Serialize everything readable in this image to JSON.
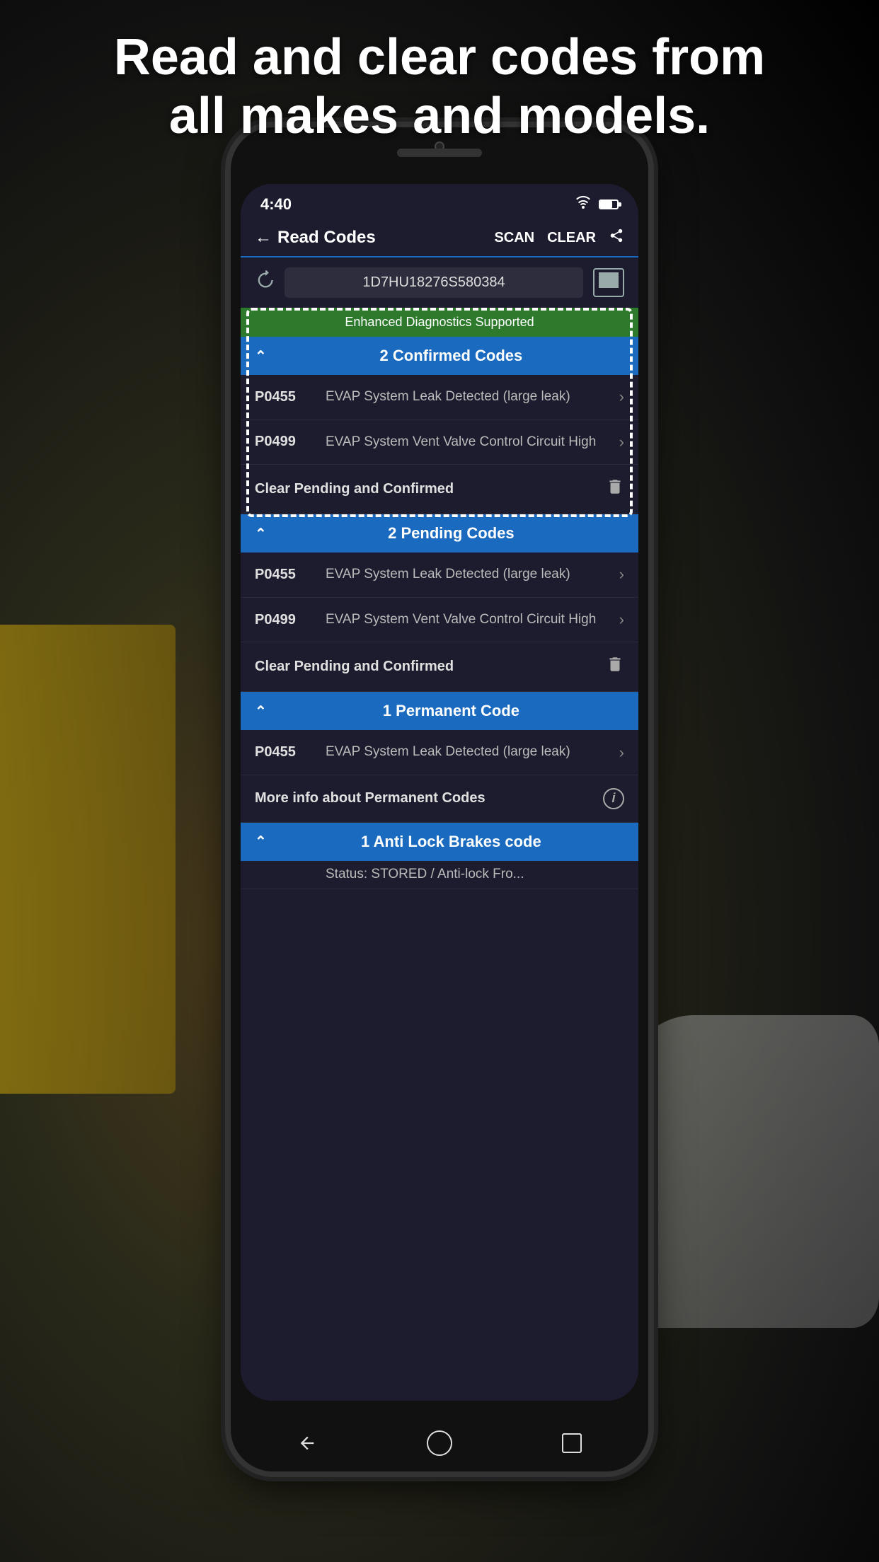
{
  "headline": {
    "line1": "Read and clear codes from",
    "line2": "all makes and models."
  },
  "status_bar": {
    "time": "4:40",
    "wifi": "▲",
    "battery_label": "battery"
  },
  "top_bar": {
    "back_label": "← Read Codes",
    "scan_label": "SCAN",
    "clear_label": "CLEAR",
    "share_icon": "share"
  },
  "vin_bar": {
    "vin_value": "1D7HU18276S580384",
    "history_icon": "history",
    "barcode_icon": "barcode"
  },
  "sections": [
    {
      "id": "confirmed",
      "banner": "Enhanced Diagnostics Supported",
      "title": "2 Confirmed Codes",
      "codes": [
        {
          "code": "P0455",
          "description": "EVAP System Leak Detected (large leak)"
        },
        {
          "code": "P0499",
          "description": "EVAP System Vent Valve Control Circuit High"
        }
      ],
      "clear_label": "Clear Pending and Confirmed",
      "has_banner": true
    },
    {
      "id": "pending",
      "title": "2 Pending Codes",
      "codes": [
        {
          "code": "P0455",
          "description": "EVAP System Leak Detected (large leak)"
        },
        {
          "code": "P0499",
          "description": "EVAP System Vent Valve Control Circuit High"
        }
      ],
      "clear_label": "Clear Pending and Confirmed",
      "has_banner": false
    },
    {
      "id": "permanent",
      "title": "1 Permanent Code",
      "codes": [
        {
          "code": "P0455",
          "description": "EVAP System Leak Detected (large leak)"
        }
      ],
      "info_label": "More info about Permanent Codes",
      "has_banner": false
    },
    {
      "id": "antilock",
      "title": "1 Anti Lock Brakes code",
      "codes": [],
      "partial_visible": "Status: STORED / Anti-lock Fro...",
      "has_banner": false
    }
  ],
  "bottom_nav": {
    "back_label": "back",
    "home_label": "home",
    "recent_label": "recent"
  }
}
